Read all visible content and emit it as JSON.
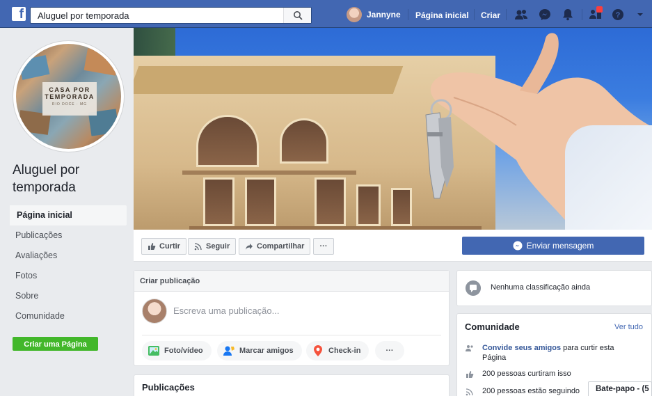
{
  "header": {
    "search_value": "Aluguel por temporada",
    "user_name": "Jannyne",
    "home_label": "Página inicial",
    "create_label": "Criar",
    "icons": [
      "friend-requests-icon",
      "messenger-icon",
      "notifications-icon",
      "page-alerts-icon",
      "help-icon",
      "menu-dropdown-icon"
    ]
  },
  "page": {
    "profile_line1": "CASA POR",
    "profile_line2": "TEMPORADA",
    "profile_line3": "RIO DOCE · MG",
    "name": "Aluguel por temporada"
  },
  "sidebar": {
    "items": [
      {
        "label": "Página inicial",
        "active": true
      },
      {
        "label": "Publicações"
      },
      {
        "label": "Avaliações"
      },
      {
        "label": "Fotos"
      },
      {
        "label": "Sobre"
      },
      {
        "label": "Comunidade"
      }
    ],
    "create_page": "Criar uma Página"
  },
  "actions": {
    "like": "Curtir",
    "follow": "Seguir",
    "share": "Compartilhar",
    "more": "···",
    "send_message": "Enviar mensagem"
  },
  "composer": {
    "title": "Criar publicação",
    "placeholder": "Escreva uma publicação...",
    "photo": "Foto/vídeo",
    "tag": "Marcar amigos",
    "checkin": "Check-in",
    "more": "···"
  },
  "posts": {
    "title": "Publicações"
  },
  "rating": {
    "text": "Nenhuma classificação ainda"
  },
  "community": {
    "title": "Comunidade",
    "see_all": "Ver tudo",
    "invite_link": "Convide seus amigos",
    "invite_rest": " para curtir esta",
    "invite_rest2": "Página",
    "likes": "200 pessoas curtiram isso",
    "follows": "200 pessoas estão seguindo"
  },
  "chat": {
    "label": "Bate-papo - (5"
  },
  "colors": {
    "brand": "#4267b2",
    "green": "#42b72a",
    "link": "#365899"
  }
}
